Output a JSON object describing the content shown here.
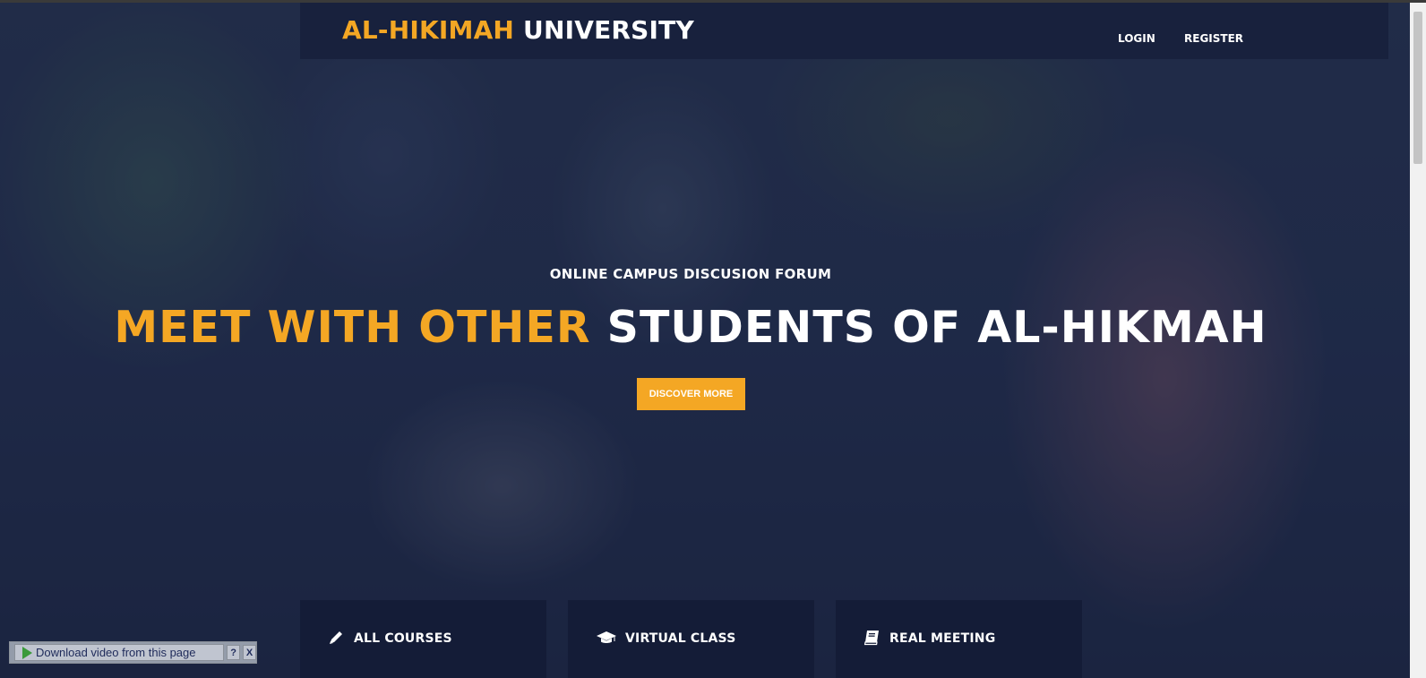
{
  "brand": {
    "part1": "AL-HIKIMAH",
    "part2": "UNIVERSITY"
  },
  "nav": {
    "login": "LOGIN",
    "register": "REGISTER"
  },
  "hero": {
    "subtitle": "ONLINE CAMPUS DISCUSION FORUM",
    "headline_accent": "MEET WITH OTHER",
    "headline_rest": "STUDENTS OF AL-HIKMAH",
    "cta": "DISCOVER MORE"
  },
  "cards": [
    {
      "label": "ALL COURSES",
      "icon": "pencil-icon"
    },
    {
      "label": "VIRTUAL CLASS",
      "icon": "graduation-cap-icon"
    },
    {
      "label": "REAL MEETING",
      "icon": "book-icon"
    }
  ],
  "download_bar": {
    "label": "Download video from this page",
    "help": "?",
    "close": "X"
  },
  "colors": {
    "accent": "#f4a724",
    "navbar": "#18213d",
    "card": "#141c37"
  }
}
